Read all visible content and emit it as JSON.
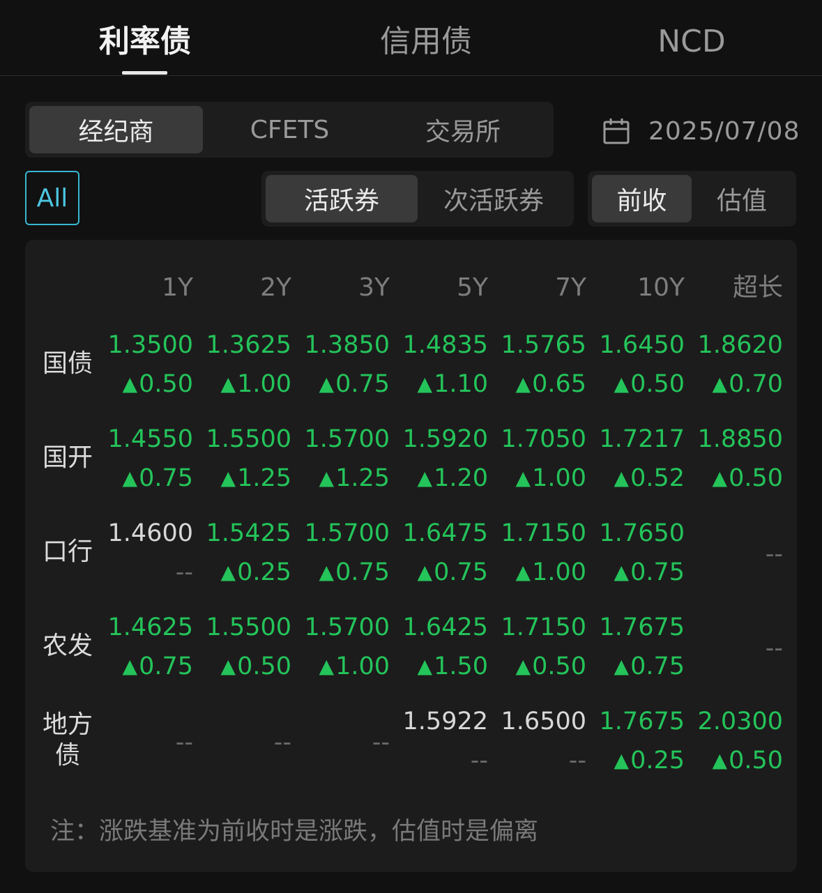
{
  "top_tabs": [
    {
      "label": "利率债",
      "active": true
    },
    {
      "label": "信用债",
      "active": false
    },
    {
      "label": "NCD",
      "active": false
    }
  ],
  "source_tabs": [
    {
      "label": "经纪商",
      "active": true
    },
    {
      "label": "CFETS",
      "active": false
    },
    {
      "label": "交易所",
      "active": false
    }
  ],
  "date": "2025/07/08",
  "all_button": "All",
  "activity_tabs": [
    {
      "label": "活跃券",
      "active": true
    },
    {
      "label": "次活跃券",
      "active": false
    }
  ],
  "basis_tabs": [
    {
      "label": "前收",
      "active": true
    },
    {
      "label": "估值",
      "active": false
    }
  ],
  "table": {
    "columns": [
      "1Y",
      "2Y",
      "3Y",
      "5Y",
      "7Y",
      "10Y",
      "超长"
    ],
    "rows": [
      {
        "label": "国债",
        "cells": [
          {
            "yield": "1.3500",
            "change": "0.50",
            "up": true
          },
          {
            "yield": "1.3625",
            "change": "1.00",
            "up": true
          },
          {
            "yield": "1.3850",
            "change": "0.75",
            "up": true
          },
          {
            "yield": "1.4835",
            "change": "1.10",
            "up": true
          },
          {
            "yield": "1.5765",
            "change": "0.65",
            "up": true
          },
          {
            "yield": "1.6450",
            "change": "0.50",
            "up": true
          },
          {
            "yield": "1.8620",
            "change": "0.70",
            "up": true
          }
        ]
      },
      {
        "label": "国开",
        "cells": [
          {
            "yield": "1.4550",
            "change": "0.75",
            "up": true
          },
          {
            "yield": "1.5500",
            "change": "1.25",
            "up": true
          },
          {
            "yield": "1.5700",
            "change": "1.25",
            "up": true
          },
          {
            "yield": "1.5920",
            "change": "1.20",
            "up": true
          },
          {
            "yield": "1.7050",
            "change": "1.00",
            "up": true
          },
          {
            "yield": "1.7217",
            "change": "0.52",
            "up": true
          },
          {
            "yield": "1.8850",
            "change": "0.50",
            "up": true
          }
        ]
      },
      {
        "label": "口行",
        "cells": [
          {
            "yield": "1.4600",
            "change": "--",
            "up": false
          },
          {
            "yield": "1.5425",
            "change": "0.25",
            "up": true
          },
          {
            "yield": "1.5700",
            "change": "0.75",
            "up": true
          },
          {
            "yield": "1.6475",
            "change": "0.75",
            "up": true
          },
          {
            "yield": "1.7150",
            "change": "1.00",
            "up": true
          },
          {
            "yield": "1.7650",
            "change": "0.75",
            "up": true
          },
          {
            "empty": "--"
          }
        ]
      },
      {
        "label": "农发",
        "cells": [
          {
            "yield": "1.4625",
            "change": "0.75",
            "up": true
          },
          {
            "yield": "1.5500",
            "change": "0.50",
            "up": true
          },
          {
            "yield": "1.5700",
            "change": "1.00",
            "up": true
          },
          {
            "yield": "1.6425",
            "change": "1.50",
            "up": true
          },
          {
            "yield": "1.7150",
            "change": "0.50",
            "up": true
          },
          {
            "yield": "1.7675",
            "change": "0.75",
            "up": true
          },
          {
            "empty": "--"
          }
        ]
      },
      {
        "label": "地方债",
        "label_lines": [
          "地方",
          "债"
        ],
        "cells": [
          {
            "empty": "--"
          },
          {
            "empty": "--"
          },
          {
            "empty": "--"
          },
          {
            "yield": "1.5922",
            "change": "--",
            "up": false
          },
          {
            "yield": "1.6500",
            "change": "--",
            "up": false
          },
          {
            "yield": "1.7675",
            "change": "0.25",
            "up": true
          },
          {
            "yield": "2.0300",
            "change": "0.50",
            "up": true
          }
        ]
      }
    ]
  },
  "note": "注：涨跌基准为前收时是涨跌，估值时是偏离",
  "colors": {
    "background": "#111111",
    "panel": "#1c1c1c",
    "up_green": "#24c45a",
    "accent_cyan": "#38b7d2"
  },
  "icons": {
    "date": "calendar-icon",
    "up": "triangle-up-icon"
  }
}
